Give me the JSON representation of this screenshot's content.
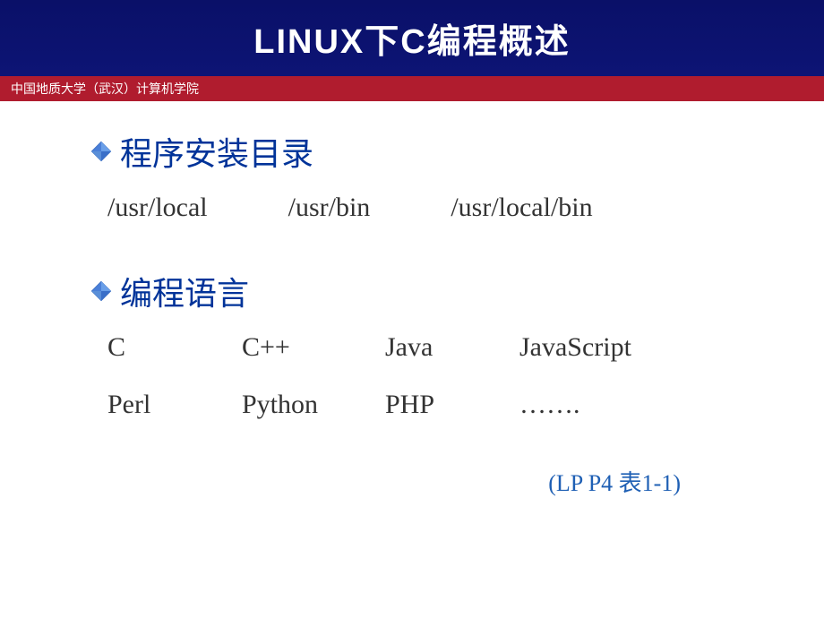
{
  "header": {
    "left_small_text": "",
    "title": "LINUX下C编程概述"
  },
  "subtitle": "中国地质大学（武汉）计算机学院",
  "section1": {
    "title": "程序安装目录",
    "paths": [
      "/usr/local",
      "/usr/bin",
      "/usr/local/bin"
    ]
  },
  "section2": {
    "title": "编程语言",
    "languages": [
      "C",
      "C++",
      "Java",
      "JavaScript",
      "Perl",
      "Python",
      "PHP",
      "……."
    ]
  },
  "footer": "(LP P4  表1-1)"
}
